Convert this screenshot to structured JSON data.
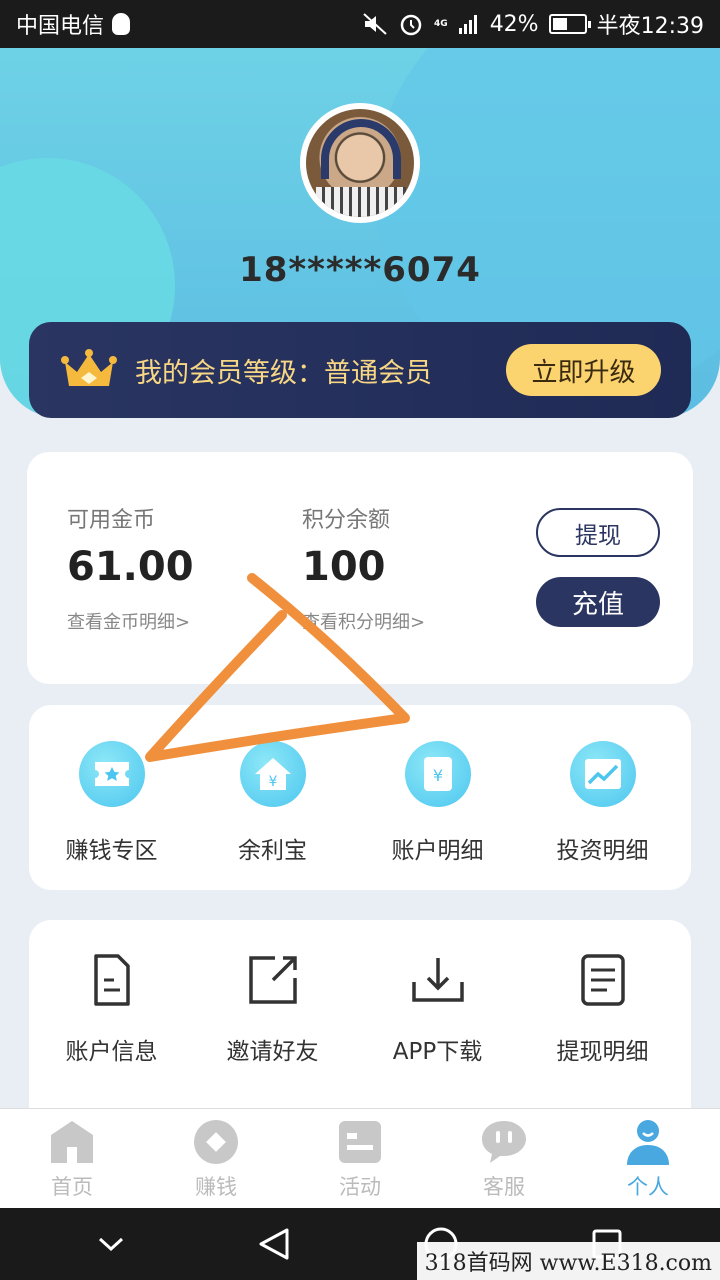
{
  "status": {
    "carrier": "中国电信",
    "battery": "42%",
    "time": "半夜12:39",
    "network": "4G"
  },
  "profile": {
    "phone": "18*****6074"
  },
  "vip": {
    "label": "我的会员等级：普通会员",
    "upgrade": "立即升级"
  },
  "balance": {
    "coins_label": "可用金币",
    "coins_value": "61.00",
    "coins_link": "查看金币明细>",
    "points_label": "积分余额",
    "points_value": "100",
    "points_link": "查看积分明细>",
    "withdraw": "提现",
    "recharge": "充值"
  },
  "grid1": [
    {
      "label": "赚钱专区",
      "icon": "ticket-icon"
    },
    {
      "label": "余利宝",
      "icon": "yuan-house-icon"
    },
    {
      "label": "账户明细",
      "icon": "yuan-receipt-icon"
    },
    {
      "label": "投资明细",
      "icon": "trend-chart-icon"
    }
  ],
  "grid2": [
    {
      "label": "账户信息",
      "icon": "document-icon"
    },
    {
      "label": "邀请好友",
      "icon": "share-icon"
    },
    {
      "label": "APP下载",
      "icon": "download-icon"
    },
    {
      "label": "提现明细",
      "icon": "list-icon"
    }
  ],
  "tabs": [
    {
      "label": "首页",
      "icon": "home-icon"
    },
    {
      "label": "赚钱",
      "icon": "earn-icon"
    },
    {
      "label": "活动",
      "icon": "activity-icon"
    },
    {
      "label": "客服",
      "icon": "chat-icon"
    },
    {
      "label": "个人",
      "icon": "person-icon",
      "active": true
    }
  ],
  "watermark": "318首码网 www.E318.com",
  "colors": {
    "accent": "#4aa8e0",
    "navy": "#2b3562",
    "gold": "#fbd36f",
    "annotation": "#f0903c"
  }
}
